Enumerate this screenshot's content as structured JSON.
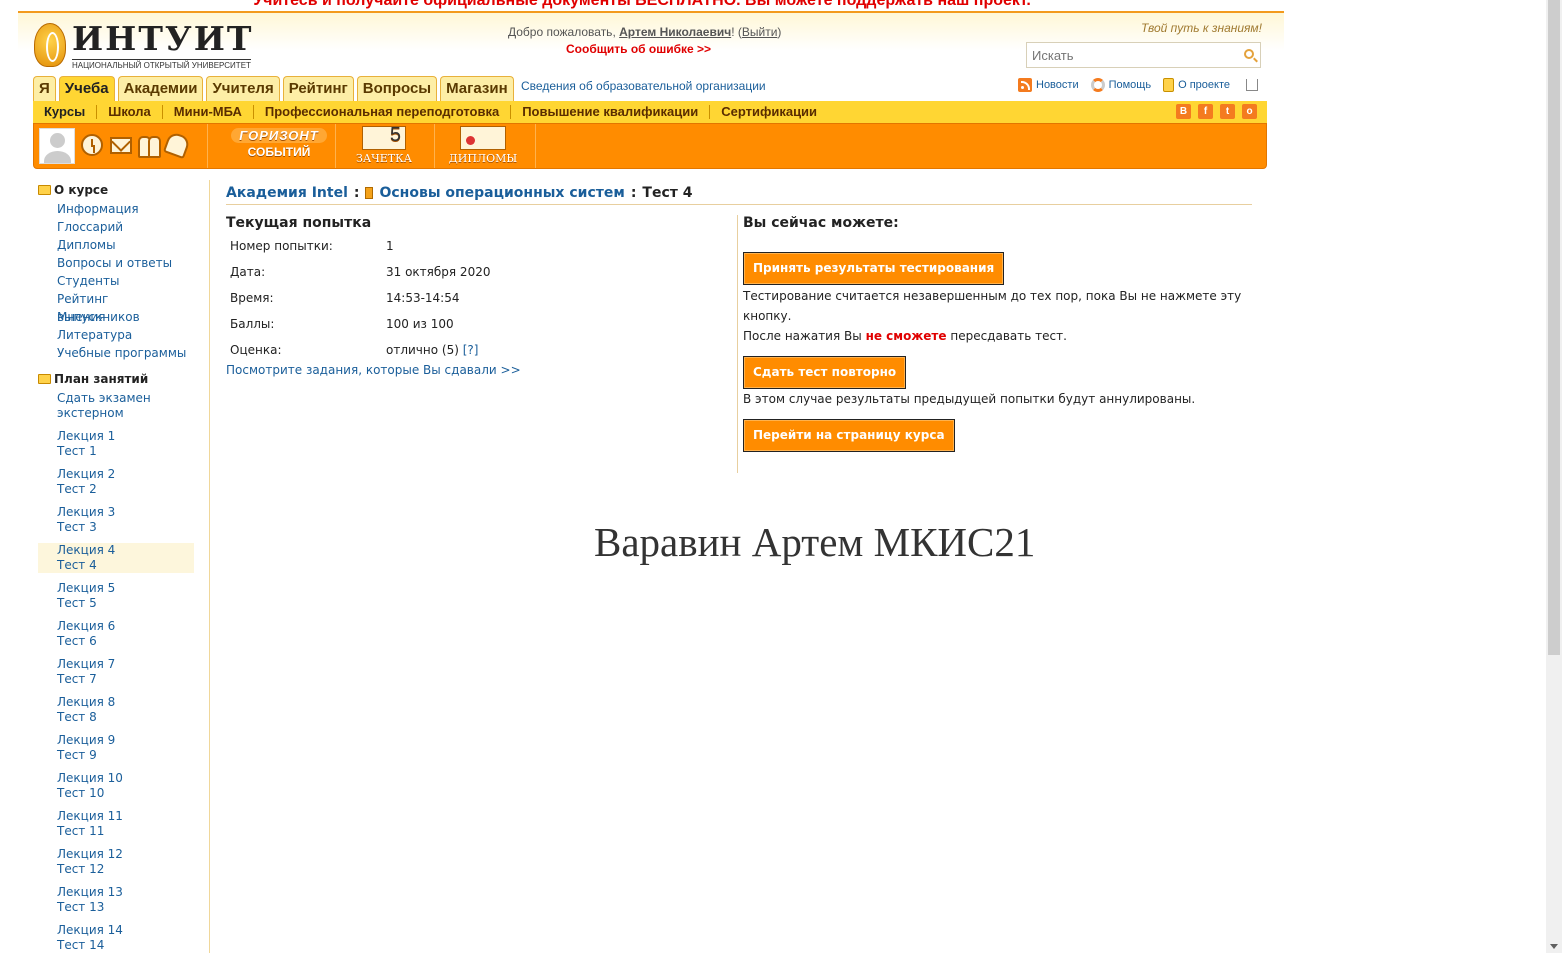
{
  "promo": "Учитесь и получайте официальные документы БЕСПЛАТНО. Вы можете поддержать наш проект.",
  "logo": {
    "word": "ИНТУИТ",
    "sub": "НАЦИОНАЛЬНЫЙ ОТКРЫТЫЙ УНИВЕРСИТЕТ"
  },
  "header": {
    "welcome_prefix": "Добро пожаловать,",
    "user_name": "Артем Николаевич",
    "logout": "Выйти",
    "report_error": "Сообщить об ошибке >>",
    "slogan": "Твой путь к знаниям!",
    "search_placeholder": "Искать"
  },
  "main_tabs": [
    "Я",
    "Учеба",
    "Академии",
    "Учителя",
    "Рейтинг",
    "Вопросы",
    "Магазин"
  ],
  "active_tab": "Учеба",
  "org_info": "Сведения об образовательной организации",
  "util_links": {
    "news": "Новости",
    "help": "Помощь",
    "about": "О проекте"
  },
  "sub_nav": [
    "Курсы",
    "Школа",
    "Мини-МБА",
    "Профессиональная переподготовка",
    "Повышение квалификации",
    "Сертификации"
  ],
  "social": [
    "В",
    "f",
    "t",
    "o"
  ],
  "icon_bar": {
    "horizon_l1": "ГОРИЗОНТ",
    "horizon_l2": "СОБЫТИЙ",
    "zachetka": "ЗАЧЕТКА",
    "diplomas": "ДИПЛОМЫ"
  },
  "sidebar": {
    "about_title": "О курсе",
    "about_items": [
      "Информация",
      "Глоссарий",
      "Дипломы",
      "Вопросы и ответы",
      "Студенты",
      "Рейтинг выпускников",
      "Мнения",
      "Литература",
      "Учебные программы"
    ],
    "plan_title": "План занятий",
    "extern": [
      "Сдать экзамен",
      "экстерном"
    ],
    "lessons": [
      {
        "lecture": "Лекция 1",
        "test": "Тест 1"
      },
      {
        "lecture": "Лекция 2",
        "test": "Тест 2"
      },
      {
        "lecture": "Лекция 3",
        "test": "Тест 3"
      },
      {
        "lecture": "Лекция 4",
        "test": "Тест 4"
      },
      {
        "lecture": "Лекция 5",
        "test": "Тест 5"
      },
      {
        "lecture": "Лекция 6",
        "test": "Тест 6"
      },
      {
        "lecture": "Лекция 7",
        "test": "Тест 7"
      },
      {
        "lecture": "Лекция 8",
        "test": "Тест 8"
      },
      {
        "lecture": "Лекция 9",
        "test": "Тест 9"
      },
      {
        "lecture": "Лекция 10",
        "test": "Тест 10"
      },
      {
        "lecture": "Лекция 11",
        "test": "Тест 11"
      },
      {
        "lecture": "Лекция 12",
        "test": "Тест 12"
      },
      {
        "lecture": "Лекция 13",
        "test": "Тест 13"
      },
      {
        "lecture": "Лекция 14",
        "test": "Тест 14"
      }
    ],
    "active_lesson": "Лекция 4"
  },
  "breadcrumb": {
    "academy": "Академия Intel",
    "course": "Основы операционных систем",
    "current": "Тест 4"
  },
  "attempt": {
    "title": "Текущая попытка",
    "rows": [
      {
        "label": "Номер попытки:",
        "value": "1"
      },
      {
        "label": "Дата:",
        "value": "31 октября 2020"
      },
      {
        "label": "Время:",
        "value": "14:53-14:54"
      },
      {
        "label": "Баллы:",
        "value": "100 из 100"
      },
      {
        "label": "Оценка:",
        "value": "отлично (5)"
      }
    ],
    "grade_help": "[?]",
    "view_tasks": "Посмотрите задания, которые Вы сдавали >>"
  },
  "actions": {
    "title": "Вы сейчас можете:",
    "accept_button": "Принять результаты тестирования",
    "accept_note1": "Тестирование считается незавершенным до тех пор, пока Вы не нажмете эту кнопку.",
    "accept_note2_prefix": "После нажатия Вы",
    "accept_note2_warn": "не сможете",
    "accept_note2_suffix": "пересдавать тест.",
    "retake_button": "Сдать тест повторно",
    "retake_note": "В этом случае результаты предыдущей попытки будут аннулированы.",
    "course_button": "Перейти на страницу курса"
  },
  "signature": "Варавин Артем МКИС21"
}
